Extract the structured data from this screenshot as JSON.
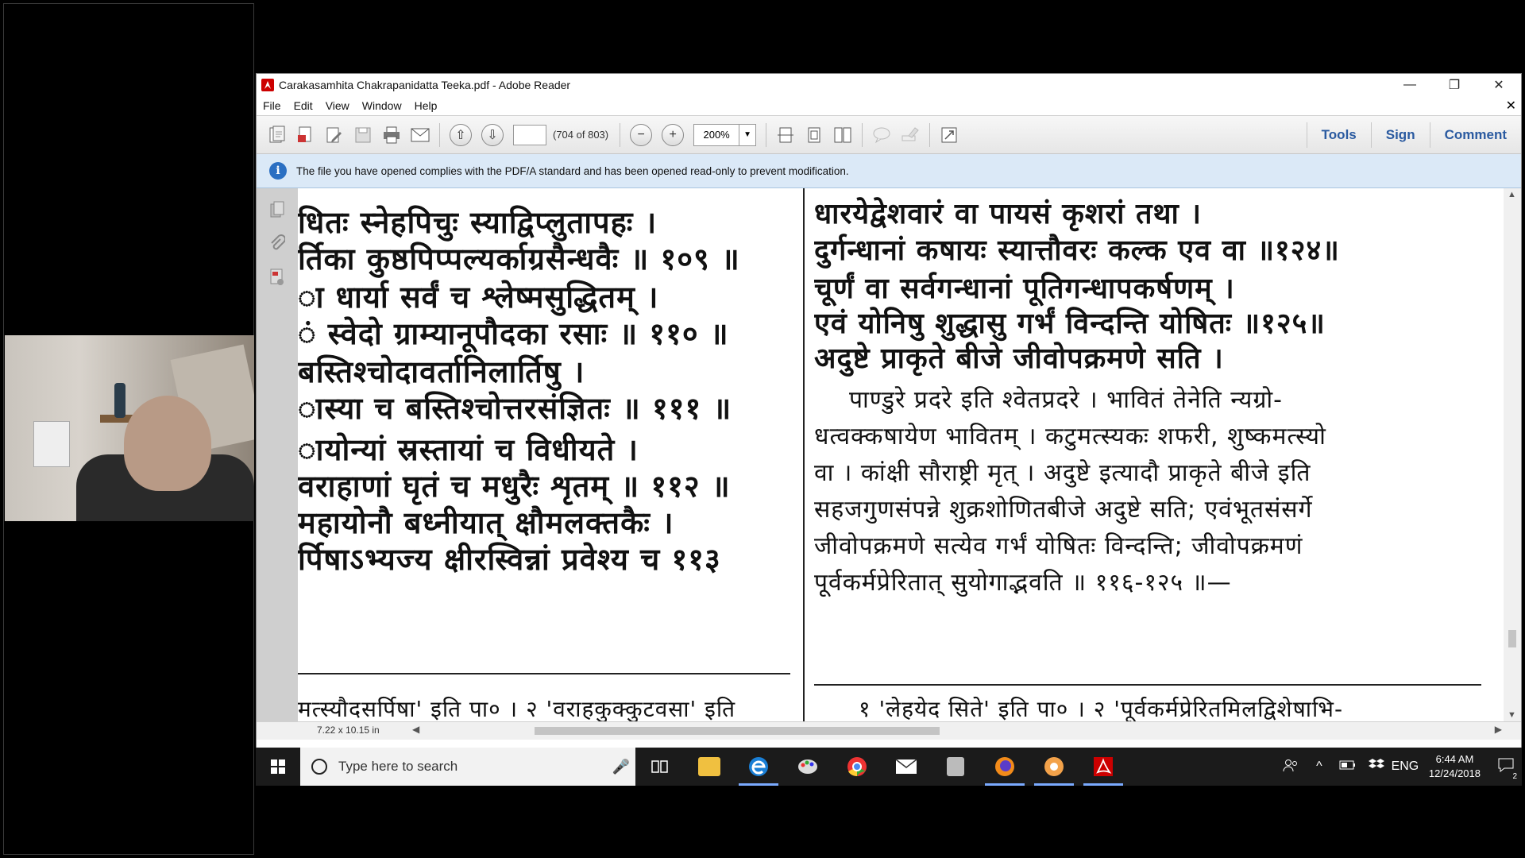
{
  "window": {
    "title": "Carakasamhita Chakrapanidatta Teeka.pdf - Adobe Reader",
    "minimize": "—",
    "restore": "❐",
    "close": "✕"
  },
  "menu": [
    "File",
    "Edit",
    "View",
    "Window",
    "Help"
  ],
  "menu_close": "✕",
  "toolbar": {
    "page_value": "",
    "page_count": "(704 of 803)",
    "zoom": "200%",
    "zoom_drop": "▼",
    "prev_page": "⇧",
    "next_page": "⇩",
    "zoom_out": "−",
    "zoom_in": "+",
    "tools": "Tools",
    "sign": "Sign",
    "comment": "Comment"
  },
  "infobar": {
    "icon": "i",
    "message": "The file you have opened complies with the PDF/A standard and has been opened read-only to prevent modification."
  },
  "page": {
    "left_lines": [
      "धितः स्नेहपिचुः स्याद्विप्लुतापहः ।",
      "र्तिका कुष्ठपिप्पल्यर्काग्रसैन्धवैः ॥ १०९ ॥",
      "ा धार्या सर्वं च श्लेष्मसुद्धितम् ।",
      "ं स्वेदो ग्राम्यानूपौदका रसाः ॥ ११० ॥",
      "बस्तिश्चोदावर्तानिलार्तिषु ।",
      "ास्या च बस्तिश्चोत्तरसंज्ञितः ॥ १११ ॥",
      "ायोन्यां स्रस्तायां च विधीयते ।",
      "वराहाणां घृतं च मधुरैः शृतम् ॥ ११२ ॥",
      "महायोनौ बध्नीयात् क्षौमलक्तकैः ।",
      "र्पिषाऽभ्यज्य क्षीरस्विन्नां प्रवेश्य च ११३"
    ],
    "left_footnote": "मत्स्यौदसर्पिषा' इति पा० । २ 'वराहकुक्कुटवसा' इति",
    "right_lines": [
      "धारयेद्वेशवारं वा पायसं कृशरां तथा ।",
      "दुर्गन्धानां कषायः स्यात्तौवरः कल्क एव वा ॥१२४॥",
      "चूर्णं वा सर्वगन्धानां पूतिगन्धापकर्षणम् ।",
      "एवं योनिषु शुद्धासु गर्भं विन्दन्ति योषितः ॥१२५॥",
      "अदुष्टे प्राकृते बीजे जीवोपक्रमणे सति ।"
    ],
    "commentary_lines": [
      "पाण्डुरे प्रदरे इति श्वेतप्रदरे । भावितं तेनेति न्यग्रो-",
      "धत्वक्कषायेण भावितम् । कटुमत्स्यकः शफरी, शुष्कमत्स्यो",
      "वा । कांक्षी सौराष्ट्री मृत् । अदुष्टे इत्यादौ प्राकृते बीजे इति",
      "सहजगुणसंपन्ने शुक्रशोणितबीजे अदुष्टे सति; एवंभूतसंसर्गे",
      "जीवोपक्रमणे सत्येव गर्भं योषितः विन्दन्ति; जीवोपक्रमणं",
      "पूर्वकर्मप्रेरितात् सुयोगाद्भवति ॥ ११६-१२५ ॥—"
    ],
    "right_footnote": "१ 'लेहयेद सिते' इति पा० । २ 'पूर्वकर्मप्रेरितमिलद्विशेषाभि-"
  },
  "status": {
    "page_size": "7.22 x 10.15 in",
    "scroll_left": "◀",
    "scroll_right": "▶",
    "scroll_up": "▲",
    "scroll_down": "▼"
  },
  "taskbar": {
    "search_placeholder": "Type here to search",
    "mic": "🎤",
    "tray_lang": "ENG",
    "time": "6:44 AM",
    "date": "12/24/2018",
    "notif_count": "2",
    "tray_up": "^"
  },
  "colors": {
    "accent": "#2a5aa0",
    "infobar": "#dbe9f7",
    "taskbar": "#1b1b1b"
  }
}
